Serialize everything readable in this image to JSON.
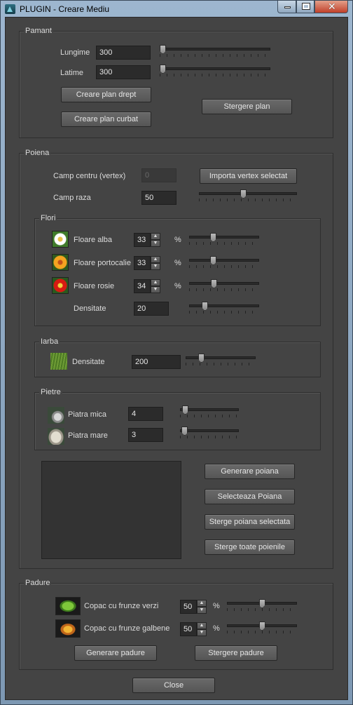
{
  "window": {
    "title": "PLUGIN - Creare Mediu"
  },
  "pamant": {
    "title": "Pamant",
    "lungime_label": "Lungime",
    "lungime_value": "300",
    "lungime_slider": 0.0,
    "latime_label": "Latime",
    "latime_value": "300",
    "latime_slider": 0.0,
    "btn_plan_drept": "Creare plan drept",
    "btn_plan_curbat": "Creare plan curbat",
    "btn_stergere_plan": "Stergere plan"
  },
  "poiena": {
    "title": "Poiena",
    "camp_centru_label": "Camp centru (vertex)",
    "camp_centru_value": "0",
    "btn_importa": "Importa vertex selectat",
    "camp_raza_label": "Camp raza",
    "camp_raza_value": "50",
    "camp_raza_slider": 0.45,
    "flori": {
      "title": "Flori",
      "items": [
        {
          "label": "Floare alba",
          "value": "33",
          "unit": "%",
          "slider": 0.33,
          "icon": "white-daisy-icon"
        },
        {
          "label": "Floare portocalie",
          "value": "33",
          "unit": "%",
          "slider": 0.33,
          "icon": "orange-flower-icon"
        },
        {
          "label": "Floare rosie",
          "value": "34",
          "unit": "%",
          "slider": 0.34,
          "icon": "red-flower-icon"
        }
      ],
      "densitate_label": "Densitate",
      "densitate_value": "20",
      "densitate_slider": 0.2
    },
    "iarba": {
      "title": "Iarba",
      "densitate_label": "Densitate",
      "densitate_value": "200",
      "densitate_slider": 0.2
    },
    "pietre": {
      "title": "Pietre",
      "piatra_mica_label": "Piatra mica",
      "piatra_mica_value": "4",
      "piatra_mica_slider": 0.04,
      "piatra_mare_label": "Piatra mare",
      "piatra_mare_value": "3",
      "piatra_mare_slider": 0.03
    },
    "btn_generare": "Generare poiana",
    "btn_selecteaza": "Selecteaza Poiana",
    "btn_sterge_selectata": "Sterge poiana selectata",
    "btn_sterge_toate": "Sterge toate poienile"
  },
  "padure": {
    "title": "Padure",
    "items": [
      {
        "label": "Copac cu frunze verzi",
        "value": "50",
        "unit": "%",
        "slider": 0.5
      },
      {
        "label": "Copac cu frunze galbene",
        "value": "50",
        "unit": "%",
        "slider": 0.5
      }
    ],
    "btn_generare": "Generare padure",
    "btn_stergere": "Stergere padure"
  },
  "btn_close": "Close"
}
